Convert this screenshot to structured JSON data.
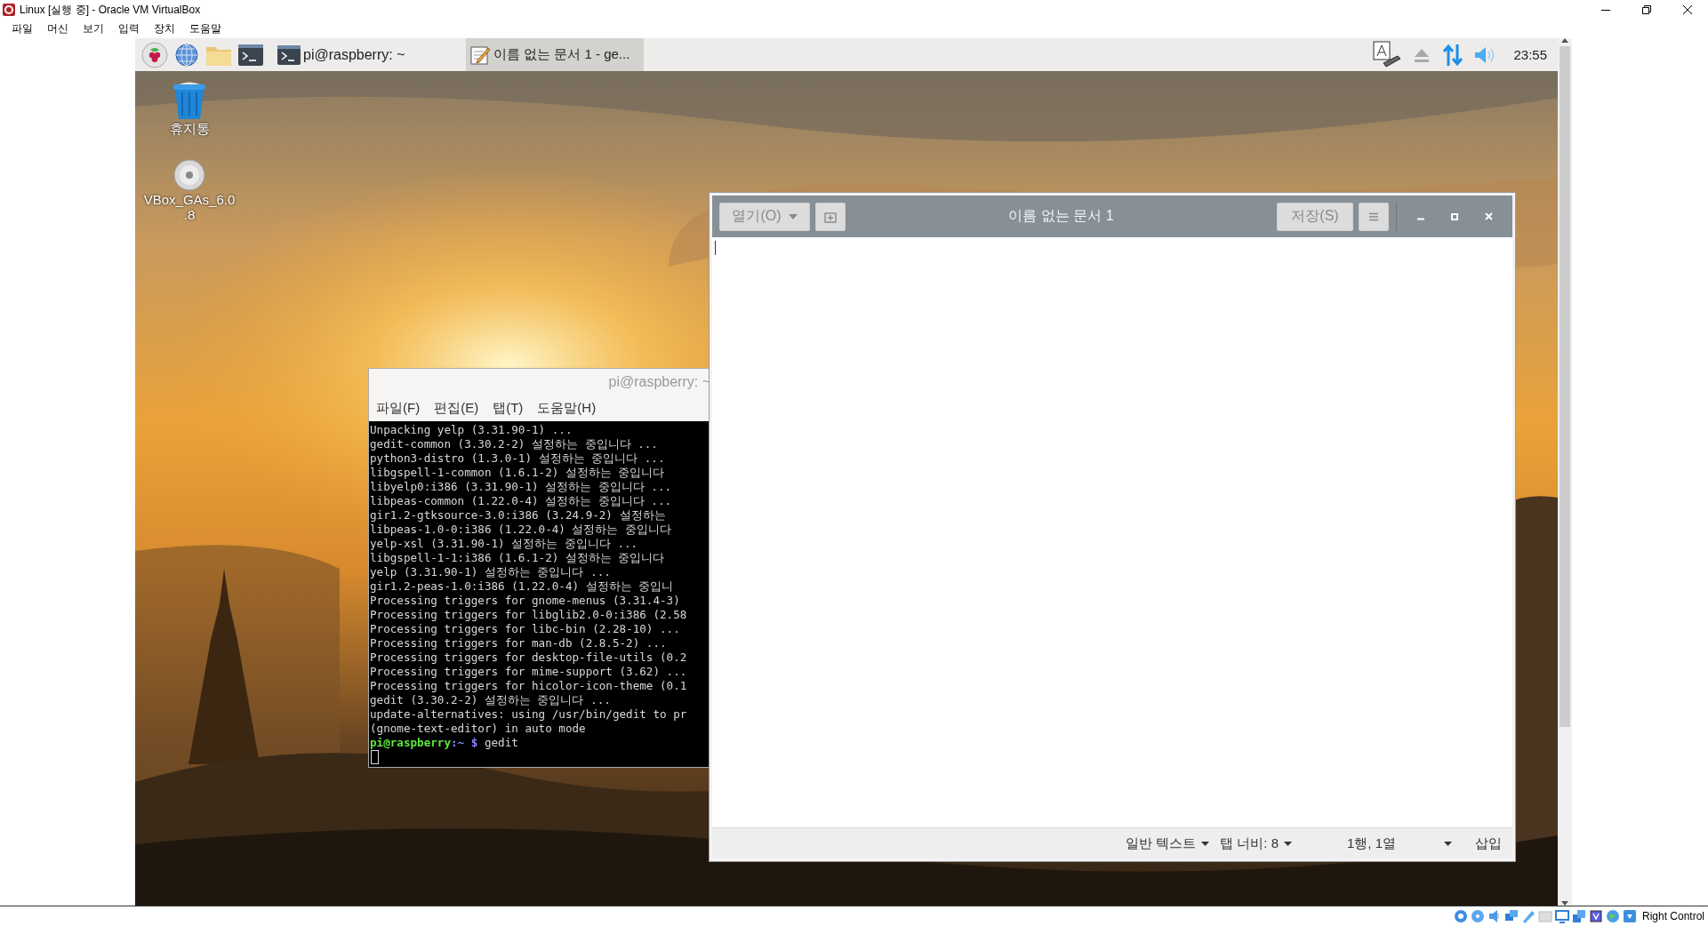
{
  "host_window": {
    "title": "Linux [실행 중] - Oracle VM VirtualBox",
    "menu": [
      "파일",
      "머신",
      "보기",
      "입력",
      "장치",
      "도움말"
    ],
    "status_text": "Right Control"
  },
  "taskbar": {
    "launchers": [
      {
        "kind": "raspberry"
      },
      {
        "kind": "globe"
      },
      {
        "kind": "folder"
      },
      {
        "kind": "terminal"
      }
    ],
    "tasks": [
      {
        "label": "pi@raspberry: ~",
        "kind": "terminal",
        "selected": false
      },
      {
        "label": "이름 없는 문서 1 - ge...",
        "kind": "editor",
        "selected": true
      }
    ],
    "clock": "23:55"
  },
  "desktop_icons": [
    {
      "kind": "trash",
      "label_lines": [
        "휴지통"
      ]
    },
    {
      "kind": "disc",
      "label_lines": [
        "VBox_GAs_6.0",
        ".8"
      ]
    }
  ],
  "terminal": {
    "title": "pi@raspberry: ~",
    "menu": [
      "파일(F)",
      "편집(E)",
      "탭(T)",
      "도움말(H)"
    ],
    "lines": [
      "Unpacking yelp (3.31.90-1) ...",
      "gedit-common (3.30.2-2) 설정하는 중입니다 ...",
      "python3-distro (1.3.0-1) 설정하는 중입니다 ...",
      "libgspell-1-common (1.6.1-2) 설정하는 중입니다",
      "libyelp0:i386 (3.31.90-1) 설정하는 중입니다 ...",
      "libpeas-common (1.22.0-4) 설정하는 중입니다 ...",
      "gir1.2-gtksource-3.0:i386 (3.24.9-2) 설정하는",
      "libpeas-1.0-0:i386 (1.22.0-4) 설정하는 중입니다",
      "yelp-xsl (3.31.90-1) 설정하는 중입니다 ...",
      "libgspell-1-1:i386 (1.6.1-2) 설정하는 중입니다",
      "yelp (3.31.90-1) 설정하는 중입니다 ...",
      "gir1.2-peas-1.0:i386 (1.22.0-4) 설정하는 중입니",
      "Processing triggers for gnome-menus (3.31.4-3)",
      "Processing triggers for libglib2.0-0:i386 (2.58",
      "Processing triggers for libc-bin (2.28-10) ...",
      "Processing triggers for man-db (2.8.5-2) ...",
      "Processing triggers for desktop-file-utils (0.2",
      "Processing triggers for mime-support (3.62) ...",
      "Processing triggers for hicolor-icon-theme (0.1",
      "gedit (3.30.2-2) 설정하는 중입니다 ...",
      "update-alternatives: using /usr/bin/gedit to pr",
      "(gnome-text-editor) in auto mode"
    ],
    "prompt": {
      "user_host": "pi@raspberry",
      "path": ":~",
      "symbol": "$",
      "command": " gedit"
    }
  },
  "editor": {
    "open_button": "열기(O)",
    "title": "이름 없는 문서 1",
    "save_button": "저장(S)",
    "status": {
      "language": "일반 텍스트",
      "tab_width": "탭 너비: 8",
      "position": "1행, 1열",
      "mode": "삽입"
    }
  }
}
